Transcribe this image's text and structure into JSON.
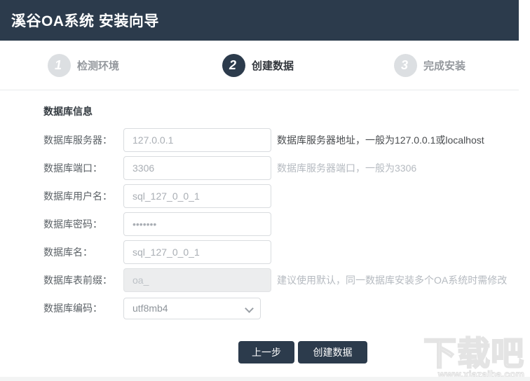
{
  "header": {
    "title": "溪谷OA系统 安装向导"
  },
  "steps": [
    {
      "number": "1",
      "label": "检测环境",
      "active": false
    },
    {
      "number": "2",
      "label": "创建数据",
      "active": true
    },
    {
      "number": "3",
      "label": "完成安装",
      "active": false
    }
  ],
  "form": {
    "section_title": "数据库信息",
    "fields": [
      {
        "label": "数据库服务器：",
        "value": "127.0.0.1",
        "hint": "数据库服务器地址，一般为127.0.0.1或localhost"
      },
      {
        "label": "数据库端口：",
        "value": "3306",
        "hint": "数据库服务器端口，一般为3306"
      },
      {
        "label": "数据库用户名：",
        "value": "sql_127_0_0_1",
        "hint": ""
      },
      {
        "label": "数据库密码：",
        "value": "•••••••",
        "hint": ""
      },
      {
        "label": "数据库名：",
        "value": "sql_127_0_0_1",
        "hint": ""
      },
      {
        "label": "数据库表前缀：",
        "value": "oa_",
        "hint": "建议使用默认，同一数据库安装多个OA系统时需修改",
        "disabled": true
      },
      {
        "label": "数据库编码：",
        "value": "utf8mb4",
        "type": "select"
      }
    ]
  },
  "buttons": {
    "prev": "上一步",
    "create": "创建数据"
  },
  "watermark": {
    "title": "下载吧",
    "url": "www.xiazaiba.com"
  },
  "colors": {
    "header_bg": "#2c3b4c",
    "active_step": "#2c3b4c",
    "inactive_step": "#dcdfe2",
    "button_bg": "#2c3b4c"
  }
}
